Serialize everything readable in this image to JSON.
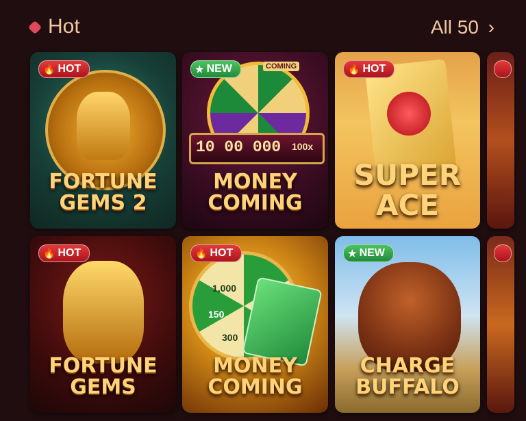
{
  "section": {
    "title": "Hot",
    "all_label": "All 50",
    "chevron": "›"
  },
  "games": [
    {
      "name_line1": "FORTUNE",
      "name_line2": "GEMS 2",
      "badge": "HOT"
    },
    {
      "name_line1": "MONEY",
      "name_line2": "COMING",
      "badge": "NEW"
    },
    {
      "name_line1": "SUPER",
      "name_line2": "ACE",
      "badge": "HOT"
    },
    {
      "name_line1": "FORTUNE",
      "name_line2": "GEMS",
      "badge": "HOT"
    },
    {
      "name_line1": "MONEY",
      "name_line2": "COMING",
      "badge": "HOT"
    },
    {
      "name_line1": "CHARGE",
      "name_line2": "BUFFALO",
      "badge": "NEW"
    }
  ],
  "art_text": {
    "money_reel": "10 00 000",
    "money_mult": "100x",
    "wheel_label": "COMING",
    "wheel_1000": "1,000",
    "wheel_150": "150",
    "wheel_300": "300"
  },
  "colors": {
    "hot": "#c9202a",
    "new": "#2fa84a",
    "gold": "#ffd37a"
  }
}
